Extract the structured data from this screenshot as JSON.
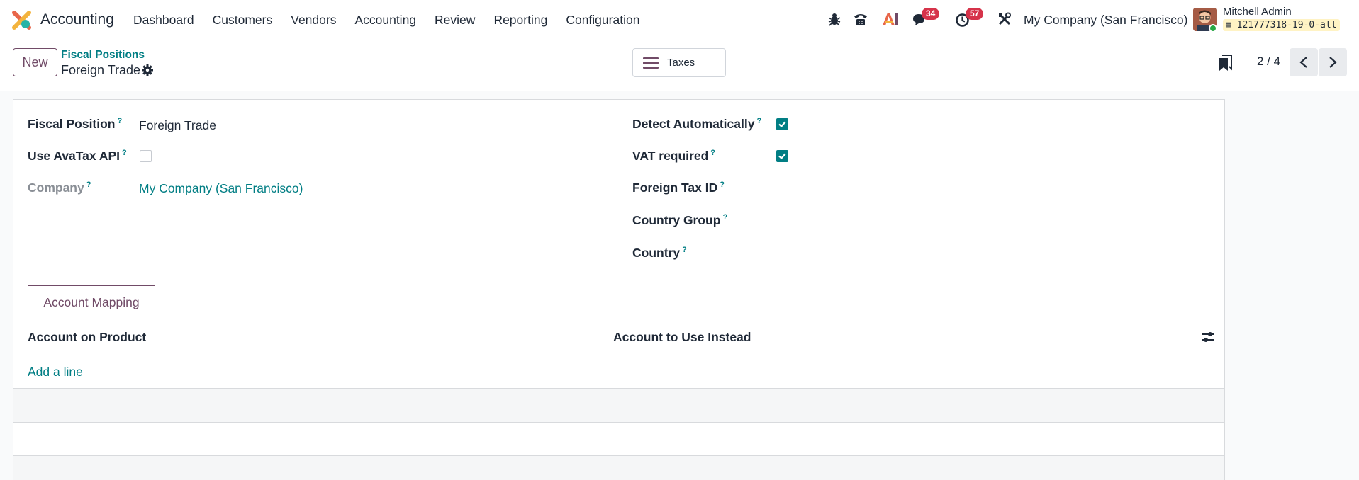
{
  "app": {
    "name": "Accounting"
  },
  "menu": [
    "Dashboard",
    "Customers",
    "Vendors",
    "Accounting",
    "Review",
    "Reporting",
    "Configuration"
  ],
  "systray": {
    "messages_count": "34",
    "activities_count": "57",
    "company": "My Company (San Francisco)",
    "user_name": "Mitchell Admin",
    "database": "121777318-19-0-all"
  },
  "control": {
    "new_label": "New",
    "breadcrumb_parent": "Fiscal Positions",
    "breadcrumb_current": "Foreign Trade",
    "smart_button_label": "Taxes",
    "pager": "2 / 4"
  },
  "form": {
    "fiscal_position_label": "Fiscal Position",
    "fiscal_position_value": "Foreign Trade",
    "use_avatax_label": "Use AvaTax API",
    "use_avatax_checked": false,
    "company_label": "Company",
    "company_value": "My Company (San Francisco)",
    "detect_auto_label": "Detect Automatically",
    "detect_auto_checked": true,
    "vat_required_label": "VAT required",
    "vat_required_checked": true,
    "foreign_tax_id_label": "Foreign Tax ID",
    "country_group_label": "Country Group",
    "country_label": "Country",
    "help_mark": "?"
  },
  "tabs": [
    {
      "label": "Account Mapping"
    }
  ],
  "table": {
    "columns": [
      "Account on Product",
      "Account to Use Instead"
    ],
    "add_line": "Add a line"
  },
  "colors": {
    "brand": "#714b67",
    "link": "#017e84",
    "badge": "#d6334a"
  }
}
